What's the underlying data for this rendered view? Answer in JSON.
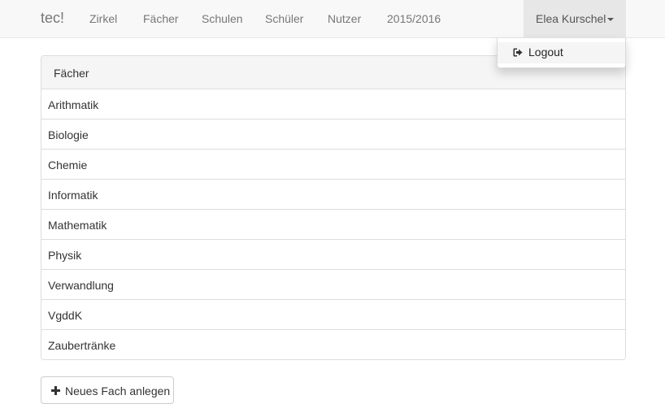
{
  "navbar": {
    "brand": "tec!",
    "links": [
      "Zirkel",
      "Fächer",
      "Schulen",
      "Schüler",
      "Nutzer",
      "2015/2016"
    ],
    "user": "Elea Kurschel"
  },
  "dropdown": {
    "items": [
      {
        "label": "Logout",
        "icon": "logout-icon"
      }
    ]
  },
  "panel": {
    "heading": "Fächer",
    "items": [
      "Arithmatik",
      "Biologie",
      "Chemie",
      "Informatik",
      "Mathematik",
      "Physik",
      "Verwandlung",
      "VgddK",
      "Zaubertränke"
    ]
  },
  "actions": {
    "add_label": "Neues Fach anlegen",
    "add_icon": "plus-icon"
  }
}
